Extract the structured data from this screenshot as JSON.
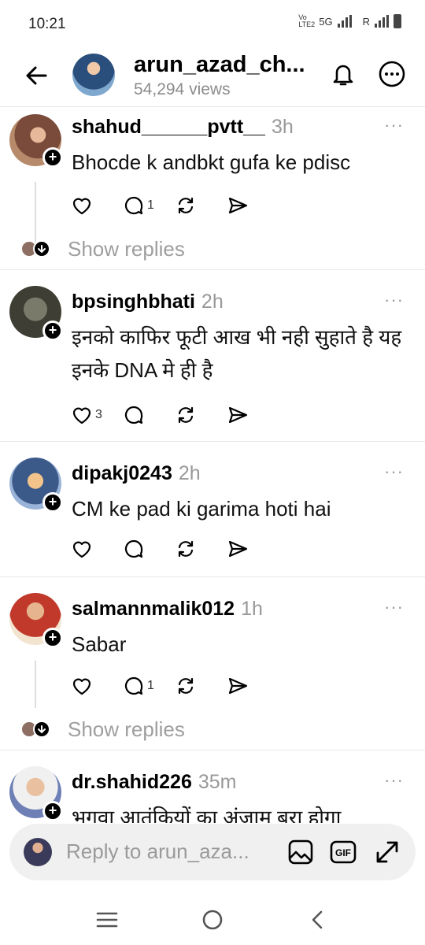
{
  "status": {
    "time": "10:21",
    "network": "5G",
    "roaming": "R",
    "volte": "Vo LTE2"
  },
  "header": {
    "title": "arun_azad_ch...",
    "views": "54,294 views"
  },
  "comments": [
    {
      "username": "shahud______pvtt__",
      "time": "3h",
      "text": "Bhocde k andbkt gufa ke pdisc",
      "likes": "",
      "replies": "1",
      "show_replies": "Show replies",
      "avatar_color": "#7a4a3a"
    },
    {
      "username": "bpsinghbhati",
      "time": "2h",
      "text": "इनको काफिर फूटी आख भी नही सुहाते है यह इनके DNA मे ही है",
      "likes": "3",
      "replies": "",
      "avatar_color": "#5a5a48"
    },
    {
      "username": "dipakj0243",
      "time": "2h",
      "text": "CM ke pad ki garima hoti hai",
      "likes": "",
      "replies": "",
      "avatar_color": "#3b5a8a"
    },
    {
      "username": "salmannmalik012",
      "time": "1h",
      "text": "Sabar",
      "likes": "",
      "replies": "1",
      "show_replies": "Show replies",
      "avatar_color": "#c0392b"
    },
    {
      "username": "dr.shahid226",
      "time": "35m",
      "text": "भगवा आतंकियों का अंजाम बुरा होगा",
      "likes": "",
      "replies": "",
      "avatar_color": "#6d7fb5"
    }
  ],
  "reply_bar": {
    "placeholder": "Reply to arun_aza..."
  },
  "colors": {
    "text": "#000000",
    "muted": "#9e9e9e",
    "divider": "#e8e8e8",
    "input_bg": "#f0f0f0"
  }
}
